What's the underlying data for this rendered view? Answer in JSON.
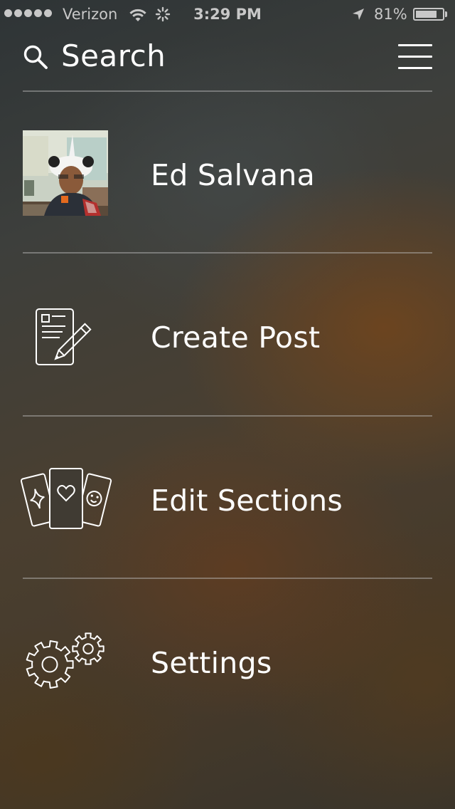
{
  "status_bar": {
    "carrier": "Verizon",
    "time": "3:29 PM",
    "battery_percent": "81%",
    "battery_level": 0.81,
    "signal_bars": 5
  },
  "header": {
    "search_label": "Search",
    "search_icon": "search-icon",
    "menu_icon": "hamburger-menu-icon"
  },
  "menu": {
    "items": [
      {
        "label": "Ed Salvana",
        "icon": "avatar-photo"
      },
      {
        "label": "Create Post",
        "icon": "compose-post-icon"
      },
      {
        "label": "Edit Sections",
        "icon": "cards-icon"
      },
      {
        "label": "Settings",
        "icon": "gears-icon"
      }
    ]
  },
  "colors": {
    "text": "#ffffff",
    "status_text": "#c8c8c8",
    "divider": "#8a8a88"
  }
}
